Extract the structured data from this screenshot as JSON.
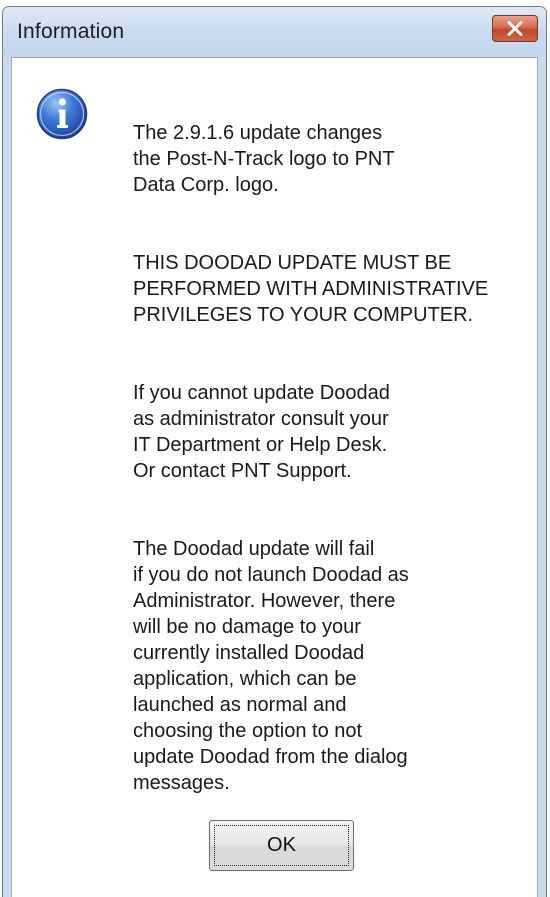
{
  "window": {
    "title": "Information"
  },
  "icons": {
    "info": "info-icon",
    "close": "close-icon"
  },
  "message": {
    "paragraphs": [
      "The 2.9.1.6 update changes\nthe Post-N-Track logo to PNT\nData Corp. logo.",
      "THIS DOODAD UPDATE MUST BE\nPERFORMED WITH ADMINISTRATIVE\nPRIVILEGES TO YOUR COMPUTER.",
      "If you cannot update Doodad\nas administrator consult your\nIT Department or Help Desk.\nOr contact PNT Support.",
      "The Doodad update will fail\nif you do not launch Doodad as\nAdministrator. However, there\nwill be no damage to your\ncurrently installed Doodad\napplication, which can be\nlaunched as normal and\nchoosing the option to not\nupdate Doodad from the dialog\nmessages."
    ]
  },
  "buttons": {
    "ok_label": "OK"
  },
  "colors": {
    "title_bar": "#c9daec",
    "close_button": "#c94a2d",
    "info_icon": "#2f63c8"
  }
}
